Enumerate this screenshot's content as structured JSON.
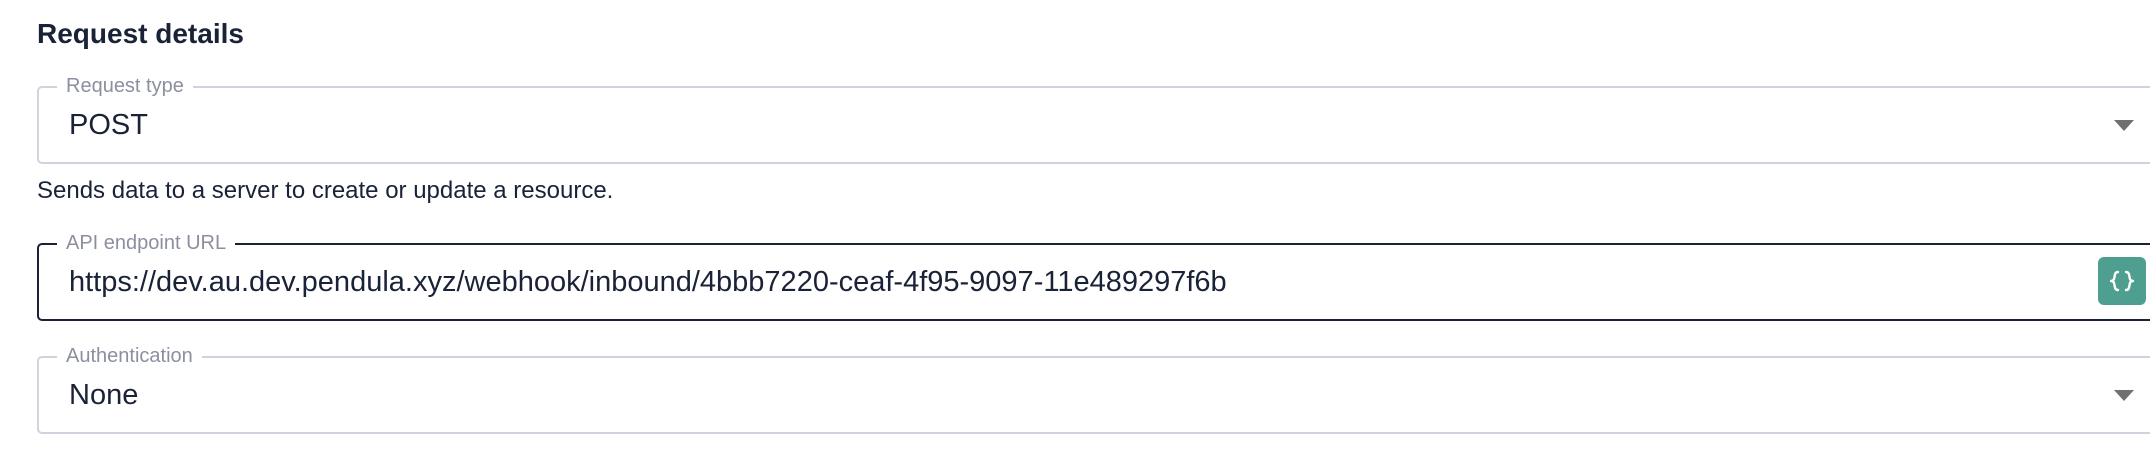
{
  "section": {
    "title": "Request details"
  },
  "request_type": {
    "label": "Request type",
    "value": "POST",
    "helper_text": "Sends data to a server to create or update a resource."
  },
  "endpoint": {
    "label": "API endpoint URL",
    "value": "https://dev.au.dev.pendula.xyz/webhook/inbound/4bbb7220-ceaf-4f95-9097-11e489297f6b",
    "variable_button_icon": "curly-braces-icon",
    "variable_button_color": "#4e9f8f",
    "focused_border_color": "#1a2238"
  },
  "authentication": {
    "label": "Authentication",
    "value": "None"
  }
}
